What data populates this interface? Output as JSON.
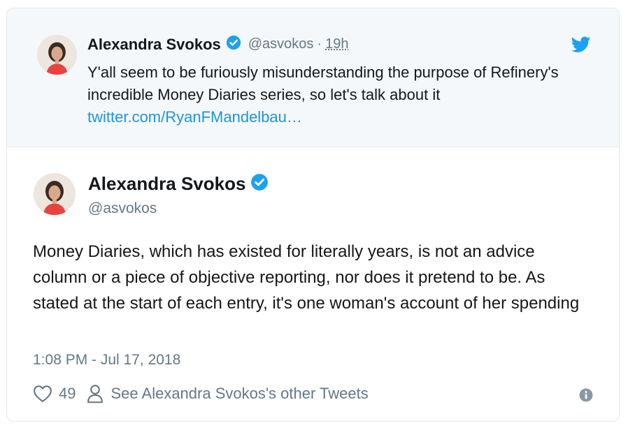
{
  "quoted_tweet": {
    "author_name": "Alexandra Svokos",
    "handle": "@asvokos",
    "separator": "·",
    "time_ago": "19h",
    "text": "Y'all seem to be furiously misunderstanding the purpose of Refinery's incredible Money Diaries series, so let's talk about it",
    "link_text": "twitter.com/RyanFMandelbau…",
    "icons": {
      "verified": "verified-badge-icon",
      "brand": "twitter-bird-icon"
    }
  },
  "main_tweet": {
    "author_name": "Alexandra Svokos",
    "handle": "@asvokos",
    "text": "Money Diaries, which has existed for literally years, is not an advice column or a piece of objective reporting, nor does it pretend to be. As stated at the start of each entry, it's one woman's account of her spending",
    "timestamp": "1:08 PM - Jul 17, 2018",
    "like_count": "49",
    "profile_link": "See Alexandra Svokos's other Tweets",
    "icons": {
      "like": "heart-icon",
      "profile": "person-icon",
      "info": "info-icon"
    }
  },
  "colors": {
    "accent": "#1da1f2",
    "link": "#1b95e0",
    "secondary_text": "#657786",
    "quoted_background": "#f5f8fa",
    "avatar_shirt": "#e8433f"
  }
}
